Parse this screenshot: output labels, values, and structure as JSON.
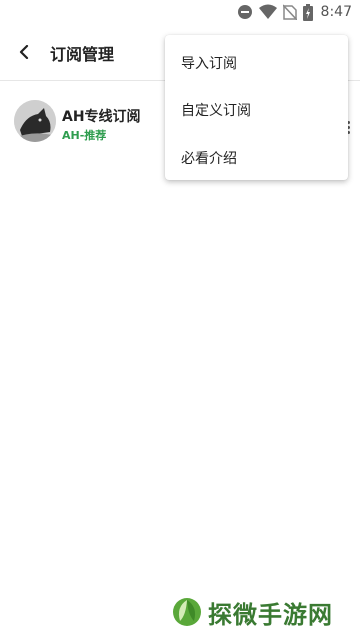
{
  "status_bar": {
    "time": "8:47",
    "icons": [
      "dnd-icon",
      "wifi-icon",
      "no-sim-icon",
      "battery-icon"
    ]
  },
  "app_bar": {
    "title": "订阅管理"
  },
  "subscription": {
    "name": "AH专线订阅",
    "tag": "AH-推荐"
  },
  "menu": {
    "items": [
      {
        "label": "导入订阅"
      },
      {
        "label": "自定义订阅"
      },
      {
        "label": "必看介绍"
      }
    ]
  },
  "watermark": {
    "text": "探微手游网"
  },
  "colors": {
    "accent_green": "#2f9d4f",
    "watermark_green": "#3a7a32"
  }
}
